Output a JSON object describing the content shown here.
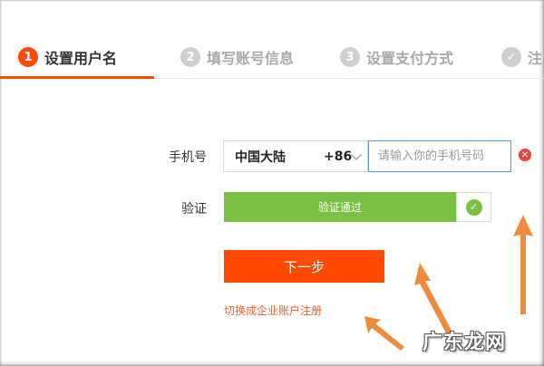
{
  "steps": [
    {
      "num": "1",
      "label": "设置用户名",
      "state": "active"
    },
    {
      "num": "2",
      "label": "填写账号信息",
      "state": "inactive"
    },
    {
      "num": "3",
      "label": "设置支付方式",
      "state": "inactive"
    },
    {
      "num": "✓",
      "label": "注",
      "state": "inactive"
    }
  ],
  "form": {
    "phone_label": "手机号",
    "country": "中国大陆",
    "country_code": "+86",
    "phone_placeholder": "请输入你的手机号码",
    "verify_label": "验证",
    "verify_status": "验证通过",
    "next_button": "下一步",
    "switch_link": "切换成企业账户注册"
  },
  "watermark": "广东龙网",
  "colors": {
    "accent": "#ff4a00",
    "success": "#7ac143",
    "error": "#e8453c",
    "link": "#e8612c",
    "input_focus": "#5b9bd5"
  },
  "icons": {
    "error": "error-x-icon",
    "verified": "check-circle-icon",
    "dropdown": "chevron-down-icon"
  }
}
